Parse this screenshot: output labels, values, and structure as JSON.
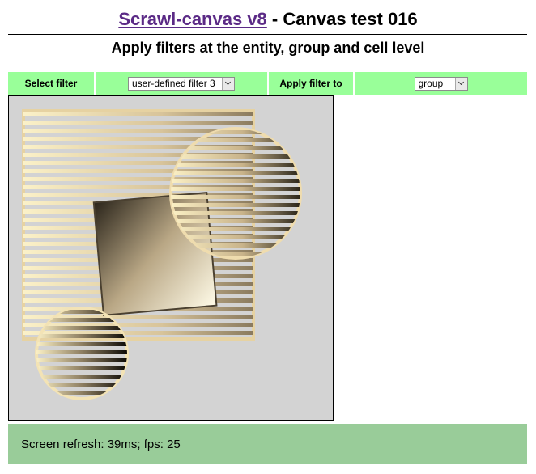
{
  "header": {
    "link_text": "Scrawl-canvas v8",
    "title_rest": " - Canvas test 016",
    "subtitle": "Apply filters at the entity, group and cell level"
  },
  "controls": {
    "select_filter_label": "Select filter",
    "filter_value": "user-defined filter 3",
    "apply_filter_to_label": "Apply filter to",
    "target_value": "group"
  },
  "status": {
    "text": "Screen refresh: 39ms; fps: 25"
  },
  "colors": {
    "link": "#5b2a86",
    "control_bg": "#99ff99",
    "status_bg": "#99cc99",
    "canvas_bg": "#d3d3d3",
    "stripe_light": "#f5ecc8",
    "stripe_dark": "#2a2418"
  }
}
